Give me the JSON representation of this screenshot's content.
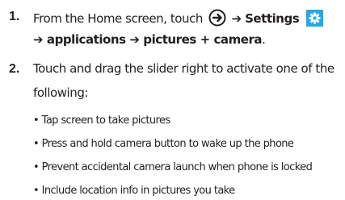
{
  "steps": [
    {
      "number": "1.",
      "line1": {
        "text_before_icon": "From the Home screen, touch",
        "arrow_sep": "➔",
        "settings_label": "Settings"
      },
      "line2": {
        "arrow_sep": "➔",
        "path_text": "applications ➔ pictures + camera",
        "period": "."
      }
    },
    {
      "number": "2.",
      "line1": "Touch and drag the slider right to activate one of the",
      "line2": "following:",
      "bullets": [
        "Tap screen to take pictures",
        "Press and hold camera button to wake up the phone",
        "Prevent accidental camera launch when phone is locked",
        "Include location info in pictures you take"
      ]
    }
  ],
  "icons": {
    "arrow_circle": "arrow-right-circle-icon",
    "settings": "settings-gear-icon",
    "settings_color": "#29a8e0"
  },
  "bullet_glyph": "•"
}
